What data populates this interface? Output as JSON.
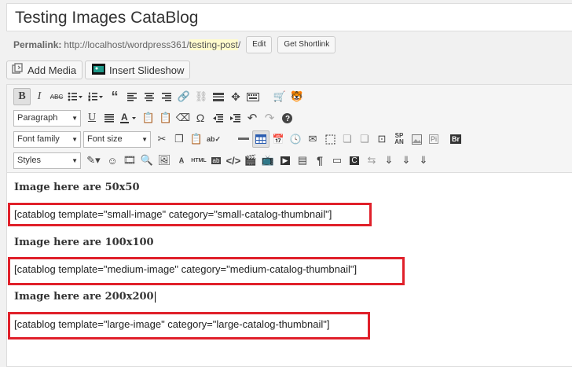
{
  "post": {
    "title": "Testing Images CataBlog",
    "permalink_label": "Permalink:",
    "permalink_base": "http://localhost/wordpress361/",
    "permalink_slug": "testing-post",
    "permalink_end": "/",
    "edit_label": "Edit",
    "shortlink_label": "Get Shortlink"
  },
  "media": {
    "add_media_label": "Add Media",
    "insert_slideshow_label": "Insert Slideshow"
  },
  "toolbar": {
    "abc_label": "ABC",
    "format_select": "Paragraph",
    "font_family_select": "Font family",
    "font_size_select": "Font size",
    "styles_select": "Styles",
    "span_label": "SP AN",
    "pi_label": "Pi",
    "br_label": "Br",
    "html_label": "HTML"
  },
  "content": {
    "heading1": "Image here are 50x50",
    "shortcode1": "[catablog template=\"small-image\" category=\"small-catalog-thumbnail\"]",
    "heading2": "Image here are 100x100",
    "shortcode2": "[catablog template=\"medium-image\" category=\"medium-catalog-thumbnail\"]",
    "heading3": "Image here are 200x200",
    "shortcode3": "[catablog template=\"large-image\" category=\"large-catalog-thumbnail\"]"
  },
  "colors": {
    "highlight_box": "#e0202a",
    "slug_highlight": "#fffbcc"
  }
}
